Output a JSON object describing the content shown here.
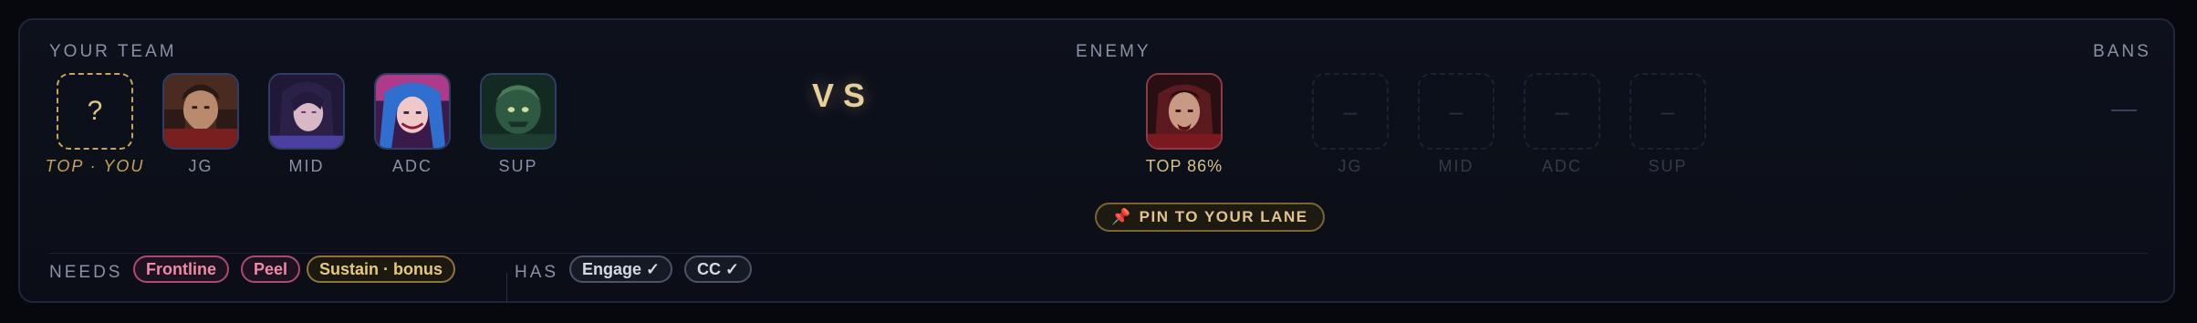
{
  "your_team": {
    "label": "YOUR TEAM",
    "you_slot": {
      "glyph": "?",
      "role_label": "TOP · YOU"
    },
    "picks": [
      {
        "role": "JG",
        "icon": "champion-portrait-bearded-warrior"
      },
      {
        "role": "MID",
        "icon": "champion-portrait-dark-hair-mage"
      },
      {
        "role": "ADC",
        "icon": "champion-portrait-blue-pigtails-gunner"
      },
      {
        "role": "SUP",
        "icon": "champion-portrait-green-creature"
      }
    ]
  },
  "vs_label": "VS",
  "enemy": {
    "label": "ENEMY",
    "pick": {
      "role_label": "TOP 86%",
      "icon": "champion-portrait-red-armored-warrior"
    },
    "empty_slots": [
      {
        "glyph": "–",
        "role": "JG"
      },
      {
        "glyph": "–",
        "role": "MID"
      },
      {
        "glyph": "–",
        "role": "ADC"
      },
      {
        "glyph": "–",
        "role": "SUP"
      }
    ],
    "pin_button": {
      "icon": "pin-icon",
      "glyph": "📌",
      "label": "PIN TO YOUR LANE"
    }
  },
  "bans": {
    "label": "BANS"
  },
  "needs": {
    "label": "NEEDS",
    "chips": [
      "Frontline",
      "Peel",
      "Sustain · bonus"
    ]
  },
  "has": {
    "label": "HAS",
    "chips": [
      "Engage ✓",
      "CC ✓"
    ]
  },
  "colors": {
    "accent_gold": "#e0c48a",
    "need_pink": "#f08aa8",
    "panel_bg": "#0d111b"
  }
}
